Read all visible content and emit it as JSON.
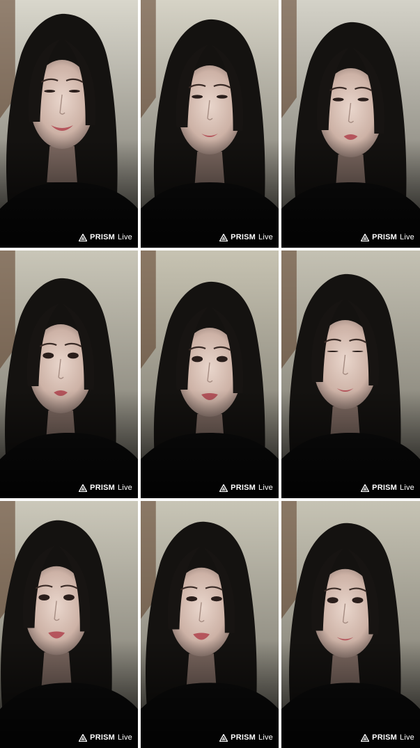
{
  "watermark": {
    "brand": "PRISM",
    "suffix": "Live",
    "logo_icon": "prism-triangle-icon"
  },
  "frames": [
    {
      "expression": "smiling",
      "wall_tone": "#d9d7cc"
    },
    {
      "expression": "looking down",
      "wall_tone": "#d6d3c6"
    },
    {
      "expression": "pursed lips",
      "wall_tone": "#d4d2c8"
    },
    {
      "expression": "eyes wide",
      "wall_tone": "#c9c6b8"
    },
    {
      "expression": "talking",
      "wall_tone": "#c7c3b2"
    },
    {
      "expression": "eyes closed",
      "wall_tone": "#c4c1b3"
    },
    {
      "expression": "talking",
      "wall_tone": "#cbc8ba"
    },
    {
      "expression": "glancing aside",
      "wall_tone": "#c8c5b6"
    },
    {
      "expression": "neutral",
      "wall_tone": "#c6c3b4"
    }
  ]
}
